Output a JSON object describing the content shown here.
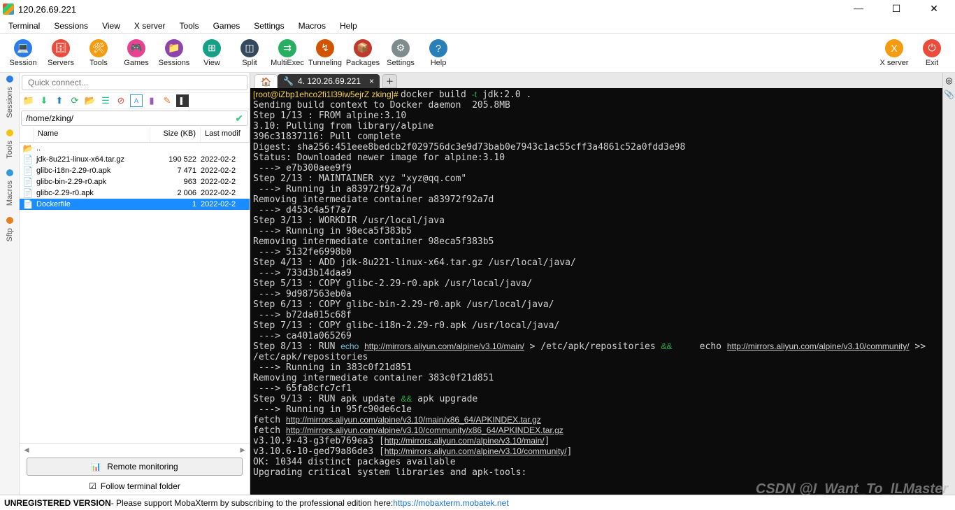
{
  "window": {
    "title": "120.26.69.221"
  },
  "menu": [
    "Terminal",
    "Sessions",
    "View",
    "X server",
    "Tools",
    "Games",
    "Settings",
    "Macros",
    "Help"
  ],
  "toolbar": [
    {
      "label": "Session",
      "color": "#2b7de9",
      "glyph": "💻"
    },
    {
      "label": "Servers",
      "color": "#e74c3c",
      "glyph": "🗄"
    },
    {
      "label": "Tools",
      "color": "#f39c12",
      "glyph": "🛠"
    },
    {
      "label": "Games",
      "color": "#e84393",
      "glyph": "🎮"
    },
    {
      "label": "Sessions",
      "color": "#8e44ad",
      "glyph": "📁"
    },
    {
      "label": "View",
      "color": "#16a085",
      "glyph": "⊞"
    },
    {
      "label": "Split",
      "color": "#34495e",
      "glyph": "◫"
    },
    {
      "label": "MultiExec",
      "color": "#27ae60",
      "glyph": "⇉"
    },
    {
      "label": "Tunneling",
      "color": "#d35400",
      "glyph": "↯"
    },
    {
      "label": "Packages",
      "color": "#c0392b",
      "glyph": "📦"
    },
    {
      "label": "Settings",
      "color": "#7f8c8d",
      "glyph": "⚙"
    },
    {
      "label": "Help",
      "color": "#2980b9",
      "glyph": "?"
    }
  ],
  "toolbar_right": [
    {
      "label": "X server",
      "color": "#f39c12",
      "glyph": "X"
    },
    {
      "label": "Exit",
      "color": "#e74c3c",
      "glyph": "⏻"
    }
  ],
  "sidetabs": [
    {
      "label": "Sessions",
      "color": "#2b7de9"
    },
    {
      "label": "Tools",
      "color": "#f1c40f"
    },
    {
      "label": "Macros",
      "color": "#3498db"
    },
    {
      "label": "Sftp",
      "color": "#e67e22"
    }
  ],
  "quick_placeholder": "Quick connect...",
  "path": "/home/zking/",
  "file_headers": {
    "name": "Name",
    "size": "Size (KB)",
    "mod": "Last modif"
  },
  "files": [
    {
      "icon": "📂",
      "name": "..",
      "size": "",
      "mod": "",
      "sel": false
    },
    {
      "icon": "📄",
      "name": "jdk-8u221-linux-x64.tar.gz",
      "size": "190 522",
      "mod": "2022-02-2",
      "sel": false
    },
    {
      "icon": "📄",
      "name": "glibc-i18n-2.29-r0.apk",
      "size": "7 471",
      "mod": "2022-02-2",
      "sel": false
    },
    {
      "icon": "📄",
      "name": "glibc-bin-2.29-r0.apk",
      "size": "963",
      "mod": "2022-02-2",
      "sel": false
    },
    {
      "icon": "📄",
      "name": "glibc-2.29-r0.apk",
      "size": "2 006",
      "mod": "2022-02-2",
      "sel": false
    },
    {
      "icon": "📄",
      "name": "Dockerfile",
      "size": "1",
      "mod": "2022-02-2",
      "sel": true
    }
  ],
  "remote_monitoring": "Remote monitoring",
  "follow": "Follow terminal folder",
  "tabs": {
    "home_icon": "🏠",
    "active_icon": "🔧",
    "active_label": "4. 120.26.69.221"
  },
  "term": {
    "prompt": "[root@iZbp1ehco2fi1l39iw5ejrZ zking]# ",
    "cmd": "docker build ",
    "flag": "-t",
    "cmd_rest": " jdk:2.0 .",
    "lines": [
      "Sending build context to Docker daemon  205.8MB",
      "Step 1/13 : FROM alpine:3.10",
      "3.10: Pulling from library/alpine",
      "396c31837116: Pull complete",
      "Digest: sha256:451eee8bedcb2f029756dc3e9d73bab0e7943c1ac55cff3a4861c52a0fdd3e98",
      "Status: Downloaded newer image for alpine:3.10",
      " ---> e7b300aee9f9",
      "Step 2/13 : MAINTAINER xyz \"xyz@qq.com\"",
      " ---> Running in a83972f92a7d",
      "Removing intermediate container a83972f92a7d",
      " ---> d453c4a5f7a7",
      "Step 3/13 : WORKDIR /usr/local/java",
      " ---> Running in 98eca5f383b5",
      "Removing intermediate container 98eca5f383b5",
      " ---> 5132fe6998b0",
      "Step 4/13 : ADD jdk-8u221-linux-x64.tar.gz /usr/local/java/",
      " ---> 733d3b14daa9",
      "Step 5/13 : COPY glibc-2.29-r0.apk /usr/local/java/",
      " ---> 9d987563eb0a",
      "Step 6/13 : COPY glibc-bin-2.29-r0.apk /usr/local/java/",
      " ---> b72da015c68f",
      "Step 7/13 : COPY glibc-i18n-2.29-r0.apk /usr/local/java/",
      " ---> ca401a065269"
    ],
    "step8_a": "Step 8/13 : RUN ",
    "step8_echo": "echo",
    "step8_url1": "http://mirrors.aliyun.com/alpine/v3.10/main/",
    "step8_b": " > /etc/apk/repositories ",
    "step8_and": "&&",
    "step8_c": "     echo ",
    "step8_url2": "http://mirrors.aliyun.com/alpine/v3.10/community/",
    "step8_d": " >> /etc/apk/repositories",
    "step8_run": " ---> Running in 383c0f21d851",
    "step8_rm": "Removing intermediate container 383c0f21d851",
    "step8_id": " ---> 65fa8cfc7cf1",
    "step9_a": "Step 9/13 : RUN apk update ",
    "step9_and": "&&",
    "step9_b": " apk upgrade",
    "step9_run": " ---> Running in 95fc90de6c1e",
    "fetch_a": "fetch ",
    "fetch_url1": "http://mirrors.aliyun.com/alpine/v3.10/main/x86_64/APKINDEX.tar.gz",
    "fetch_url2": "http://mirrors.aliyun.com/alpine/v3.10/community/x86_64/APKINDEX.tar.gz",
    "v1_a": "v3.10.9-43-g3feb769ea3 [",
    "v1_url": "http://mirrors.aliyun.com/alpine/v3.10/main/",
    "v1_b": "]",
    "v2_a": "v3.10.6-10-ged79a86de3 [",
    "v2_url": "http://mirrors.aliyun.com/alpine/v3.10/community/",
    "v2_b": "]",
    "ok": "OK: 10344 distinct packages available",
    "upg": "Upgrading critical system libraries and apk-tools:"
  },
  "status": {
    "label": "UNREGISTERED VERSION",
    "text": "  -  Please support MobaXterm by subscribing to the professional edition here:  ",
    "url": "https://mobaxterm.mobatek.net"
  },
  "watermark": "CSDN @I_Want_To_lLMaster"
}
